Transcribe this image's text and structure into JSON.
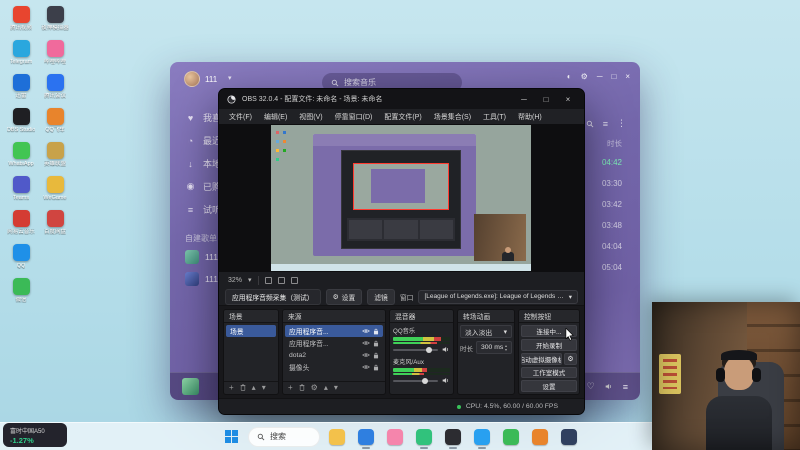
{
  "stock_widget": {
    "name": "富时中国A50",
    "change": "-1.27%"
  },
  "taskbar": {
    "search_label": "搜索",
    "apps": [
      {
        "name": "file-explorer",
        "color": "#f3c14b",
        "running": false
      },
      {
        "name": "edge-browser",
        "color": "#2f7fe0",
        "running": true
      },
      {
        "name": "bilibili",
        "color": "#f585ac",
        "running": false
      },
      {
        "name": "qq-music",
        "color": "#31c27c",
        "running": true
      },
      {
        "name": "obs-studio",
        "color": "#2c2c31",
        "running": true
      },
      {
        "name": "qq",
        "color": "#28a0f0",
        "running": true
      },
      {
        "name": "wechat",
        "color": "#3bba57",
        "running": false
      },
      {
        "name": "game-launcher",
        "color": "#e8842c",
        "running": false
      },
      {
        "name": "steam",
        "color": "#30405f",
        "running": false
      }
    ]
  },
  "desktop_icons": {
    "col1": [
      {
        "label": "腾讯视频",
        "color": "#e8452f"
      },
      {
        "label": "Telegram",
        "color": "#2aa7de"
      },
      {
        "label": "迅雷",
        "color": "#1e6fd8"
      },
      {
        "label": "OBS Studio",
        "color": "#1f1f23"
      },
      {
        "label": "WhatsApp",
        "color": "#42c553"
      },
      {
        "label": "Teams",
        "color": "#5059c9"
      },
      {
        "label": "网易云音乐",
        "color": "#d43c33"
      },
      {
        "label": "QQ",
        "color": "#1f90e8"
      },
      {
        "label": "微信",
        "color": "#3bba57"
      }
    ],
    "col2": [
      {
        "label": "夜神模拟器",
        "color": "#3c3f4a"
      },
      {
        "label": "哔哩哔哩",
        "color": "#f06a9c"
      },
      {
        "label": "腾讯会议",
        "color": "#2b72f0"
      },
      {
        "label": "QQ飞车",
        "color": "#e8842c"
      },
      {
        "label": "英雄联盟",
        "color": "#c8a24a"
      },
      {
        "label": "WeGame",
        "color": "#e8b93c"
      },
      {
        "label": "百度网盘",
        "color": "#d04540"
      }
    ]
  },
  "music_app": {
    "user_name": "111",
    "search_placeholder": "搜索音乐",
    "sidebar": [
      {
        "icon": "heart",
        "label": "我喜欢"
      },
      {
        "icon": "clock",
        "label": "最近播放"
      },
      {
        "icon": "download",
        "label": "本地和下载"
      },
      {
        "icon": "disc",
        "label": "已购音乐"
      },
      {
        "icon": "list",
        "label": "试听列表"
      }
    ],
    "playlist_header": "自建歌单",
    "playlists": [
      {
        "label": "111"
      },
      {
        "label": "111"
      }
    ],
    "list_header": "时长",
    "tracks": [
      {
        "duration": "04:42",
        "playing": true
      },
      {
        "duration": "03:30",
        "playing": false
      },
      {
        "duration": "03:42",
        "playing": false
      },
      {
        "duration": "03:48",
        "playing": false
      },
      {
        "duration": "04:04",
        "playing": false
      },
      {
        "duration": "05:04",
        "playing": false
      }
    ]
  },
  "obs": {
    "title": "OBS 32.0.4 - 配置文件: 未命名 - 场景: 未命名",
    "menu": [
      "文件(F)",
      "编辑(E)",
      "视图(V)",
      "停靠窗口(D)",
      "配置文件(P)",
      "场景集合(S)",
      "工具(T)",
      "帮助(H)"
    ],
    "zoom_label": "32%",
    "source_bar": {
      "source_tab": "应用程序音频采集（测试）",
      "properties_label": "设置",
      "filters_label": "滤镜",
      "window_label": "窗口",
      "window_value": "[League of Legends.exe]: League of Legends (TM) Client"
    },
    "scenes_dock": {
      "title": "场景",
      "items": [
        {
          "name": "场景",
          "selected": true
        }
      ]
    },
    "sources_dock": {
      "title": "来源",
      "items": [
        {
          "name": "应用程序音...",
          "selected": true
        },
        {
          "name": "应用程序音...",
          "selected": false
        },
        {
          "name": "dota2",
          "selected": false
        },
        {
          "name": "摄像头",
          "selected": false
        }
      ]
    },
    "mixer_dock": {
      "title": "混音器",
      "channels": [
        {
          "name": "QQ音乐",
          "level": 0.85,
          "volume": 0.8
        },
        {
          "name": "麦克风/Aux",
          "level": 0.6,
          "volume": 0.72
        }
      ]
    },
    "transitions_dock": {
      "title": "转场动画",
      "transition": "淡入淡出",
      "duration_label": "时长",
      "duration_value": "300 ms"
    },
    "controls_dock": {
      "title": "控制按钮",
      "buttons": [
        "连接中...",
        "开始录制",
        "启动虚拟摄像机",
        "工作室模式",
        "设置"
      ]
    },
    "status_text": "CPU: 4.5%, 60.00 / 60.00 FPS"
  }
}
